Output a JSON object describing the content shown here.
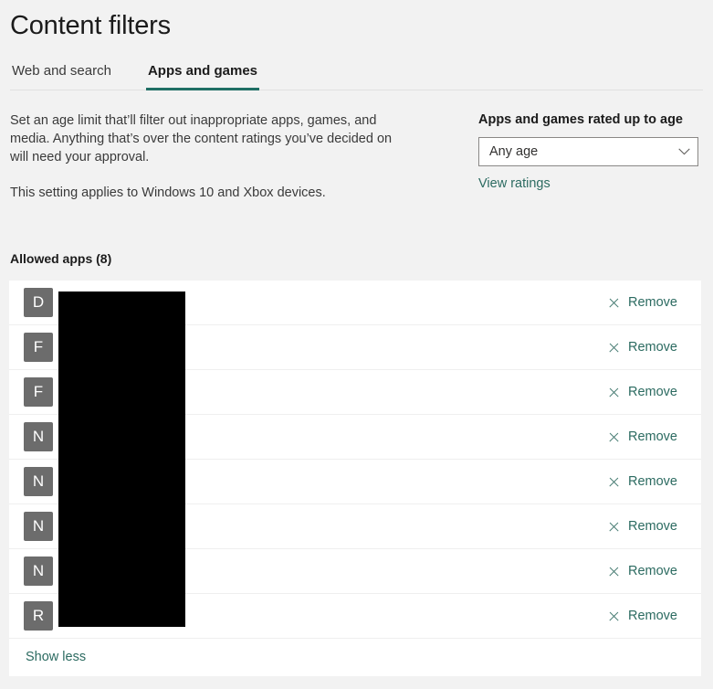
{
  "page": {
    "title": "Content filters",
    "background": "#f2f2f2",
    "accent": "#1f6e64",
    "link_color": "#2c6b61"
  },
  "tabs": [
    {
      "label": "Web and search",
      "active": false
    },
    {
      "label": "Apps and games",
      "active": true
    }
  ],
  "intro": {
    "paragraph1": "Set an age limit that’ll filter out inappropriate apps, games, and media. Anything that’s over the content ratings you’ve decided on will need your approval.",
    "paragraph2": "This setting applies to Windows 10 and Xbox devices."
  },
  "age_filter": {
    "label": "Apps and games rated up to age",
    "selected": "Any age",
    "chevron_icon": "chevron-down-icon",
    "view_ratings_label": "View ratings"
  },
  "allowed_apps": {
    "heading": "Allowed apps (8)",
    "count": 8,
    "remove_label": "Remove",
    "remove_icon": "close-x-icon",
    "show_less_label": "Show less",
    "rows": [
      {
        "initial": "D",
        "name": ""
      },
      {
        "initial": "F",
        "name": ""
      },
      {
        "initial": "F",
        "name": ""
      },
      {
        "initial": "N",
        "name": ""
      },
      {
        "initial": "N",
        "name": ""
      },
      {
        "initial": "N",
        "name": ""
      },
      {
        "initial": "N",
        "name": ""
      },
      {
        "initial": "R",
        "name": ""
      }
    ]
  }
}
